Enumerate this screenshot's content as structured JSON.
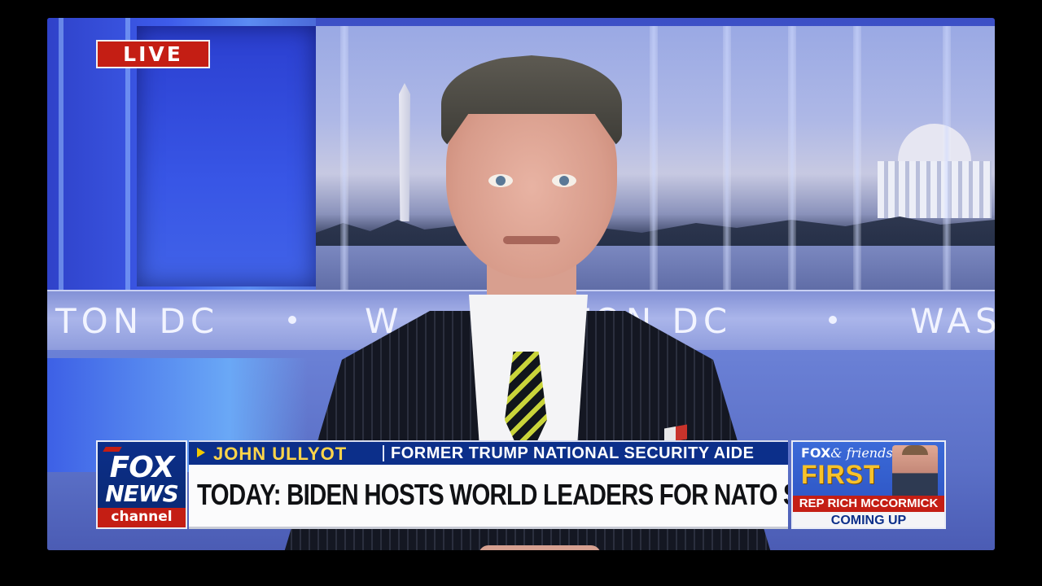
{
  "live_bug": {
    "label": "LIVE"
  },
  "background": {
    "band_text_left": "TON DC",
    "band_text_mid": "W",
    "band_text_center": "TON DC",
    "band_text_right": "WAS"
  },
  "network_logo": {
    "line1": "FOX",
    "line2": "NEWS",
    "line3": "channel"
  },
  "chyron": {
    "guest_name": "JOHN ULLYOT",
    "guest_title": "FORMER TRUMP NATIONAL SECURITY AIDE",
    "headline": "TODAY: BIDEN HOSTS WORLD LEADERS FOR NATO SUMMIT"
  },
  "promo": {
    "brand_fox": "FOX",
    "brand_friends": "& friends",
    "brand_first": "FIRST",
    "guest": "REP RICH MCCORMICK",
    "coming": "COMING UP"
  },
  "colors": {
    "fox_blue": "#0c2f8a",
    "fox_red": "#c41e14",
    "name_yellow": "#ffd54a"
  }
}
